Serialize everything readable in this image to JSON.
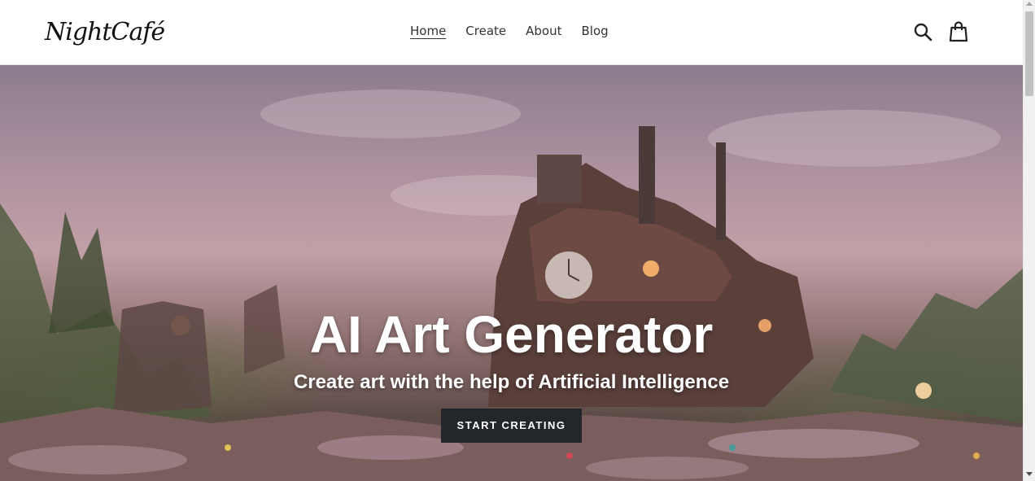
{
  "header": {
    "logo_text": "NightCafé",
    "nav": [
      {
        "label": "Home",
        "active": true
      },
      {
        "label": "Create",
        "active": false
      },
      {
        "label": "About",
        "active": false
      },
      {
        "label": "Blog",
        "active": false
      }
    ],
    "icons": [
      "search-icon",
      "cart-icon"
    ]
  },
  "hero": {
    "title": "AI Art Generator",
    "subtitle": "Create art with the help of Artificial Intelligence",
    "cta_label": "START CREATING"
  },
  "colors": {
    "cta_background": "#23262b",
    "text_dark": "#333333",
    "hero_text": "#ffffff"
  }
}
